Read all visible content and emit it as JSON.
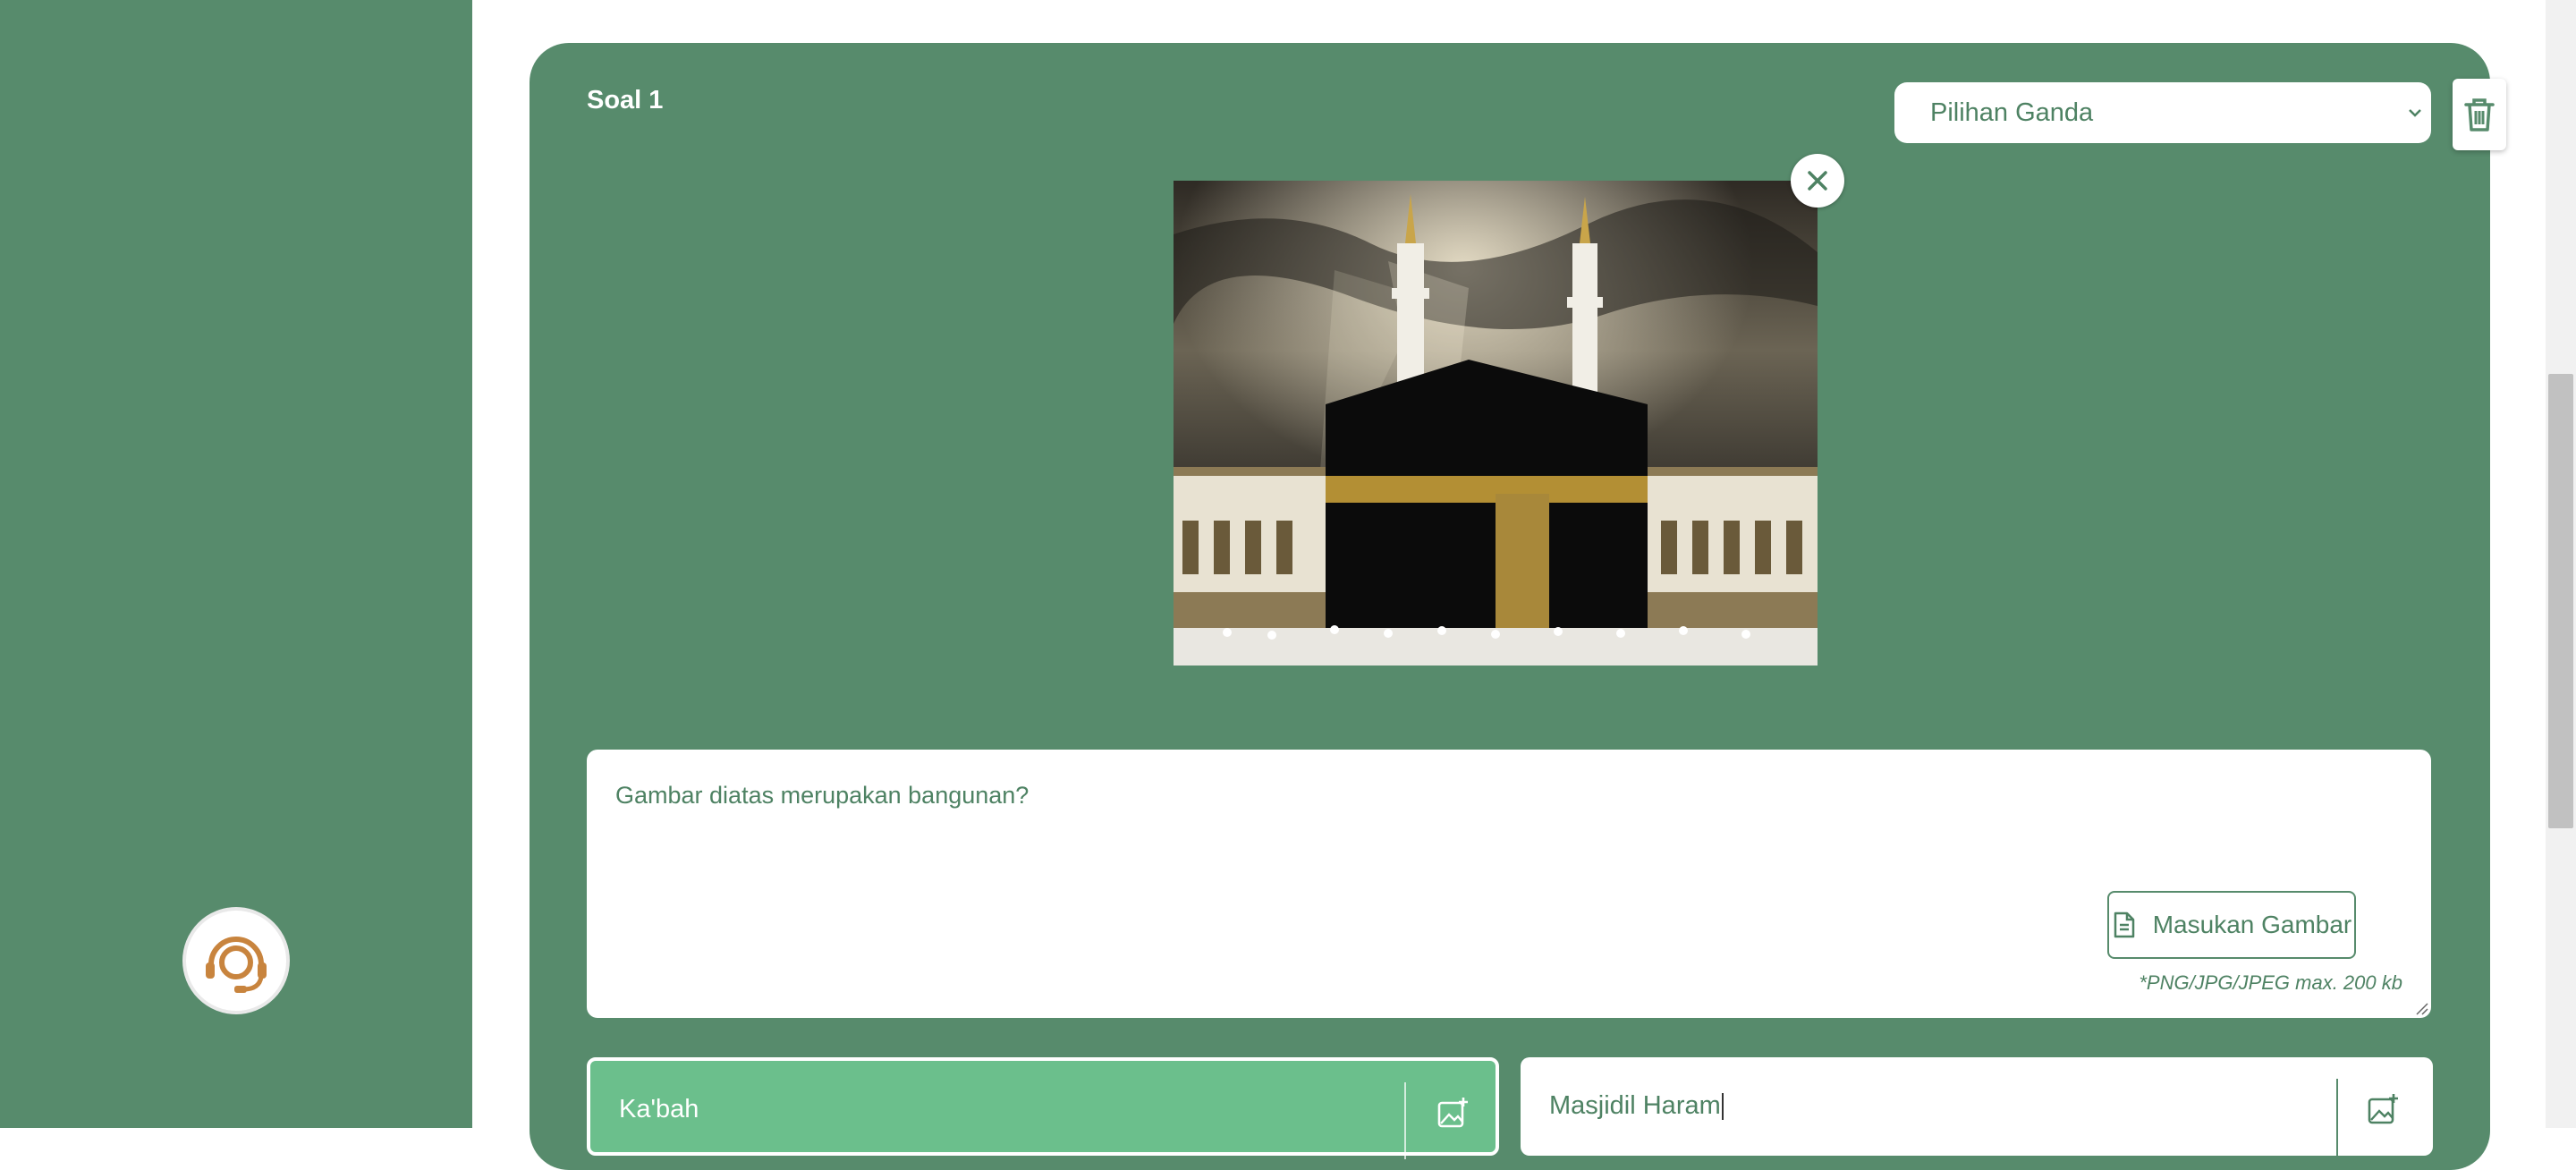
{
  "sidebar": {
    "support_icon": "headset-support-icon"
  },
  "question": {
    "title": "Soal 1",
    "type_selected": "Pilihan Ganda",
    "text": "Gambar diatas merupakan bangunan?",
    "insert_image_label": "Masukan Gambar",
    "file_hint": "*PNG/JPG/JPEG max. 200 kb"
  },
  "answers": [
    {
      "text": "Ka'bah",
      "selected": true
    },
    {
      "text": "Masjidil Haram",
      "selected": false
    }
  ],
  "colors": {
    "primary_green": "#578b6c",
    "selected_answer_green": "#6bbf8c",
    "text_green": "#4e8263",
    "support_orange": "#c8843e"
  }
}
